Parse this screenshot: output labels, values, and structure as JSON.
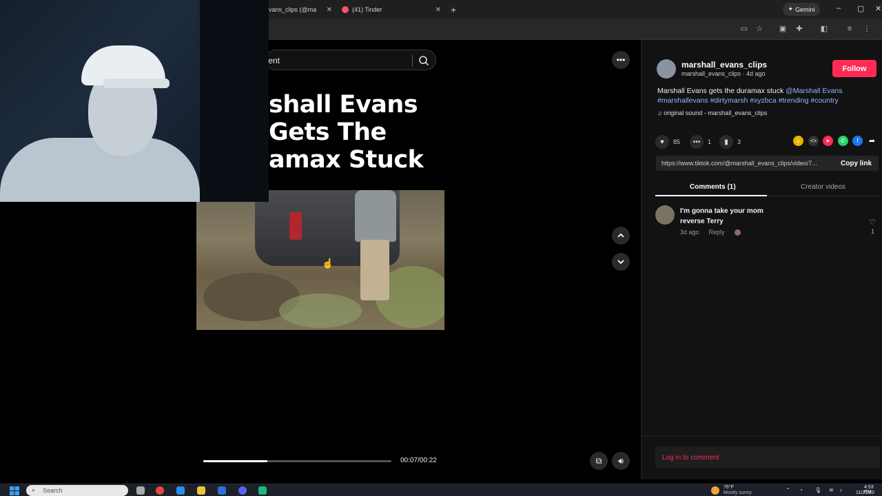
{
  "browser": {
    "tabs": [
      {
        "label": "vans_clips (@ma",
        "active": true
      },
      {
        "label": "(41) Tinder",
        "active": false
      }
    ],
    "new_tab": "+",
    "gemini_label": "Gemini",
    "close_glyph": "✕"
  },
  "page": {
    "search": {
      "text": "tent"
    },
    "overlay_title": "shall Evans\nGets The\namax Stuck",
    "player": {
      "time": "00:07/00:22",
      "progress": 0.34
    }
  },
  "post": {
    "username": "marshall_evans_clips",
    "subline": "marshall_evans_clips · 4d ago",
    "follow_label": "Follow",
    "description_text": "Marshall Evans gets the duramax stuck",
    "mention": "@Marshall Evans",
    "hashtags": "#marshallevans #dirtymarsh #xyzbca #trending #country",
    "music": "original sound - marshall_evans_clips",
    "likes": "85",
    "comments_count": "1",
    "saves": "3",
    "share_link": "https://www.tiktok.com/@marshall_evans_clips/video/7...",
    "copy_link_label": "Copy link",
    "tabs": {
      "comments": "Comments (1)",
      "creator": "Creator videos"
    },
    "comment": {
      "text": "I'm gonna take your mom reverse Terry",
      "age": "3d ago",
      "reply": "Reply",
      "likes": "1"
    },
    "login_prompt": "Log in to comment"
  },
  "taskbar": {
    "search_placeholder": "Search",
    "weather_temp": "76°F",
    "weather_cond": "Mostly sunny",
    "clock_time": "4:53 PM",
    "clock_date": "11/21/20"
  },
  "colors": {
    "accent": "#fe2c55",
    "link": "#8db8ff",
    "panel_bg": "#121212"
  },
  "icons": {
    "search": "search-icon",
    "more": "more-horizontal-icon",
    "up": "chevron-up-icon",
    "down": "chevron-down-icon",
    "volume": "volume-icon",
    "heart": "heart-icon",
    "comment": "comment-icon",
    "bookmark": "bookmark-icon"
  }
}
